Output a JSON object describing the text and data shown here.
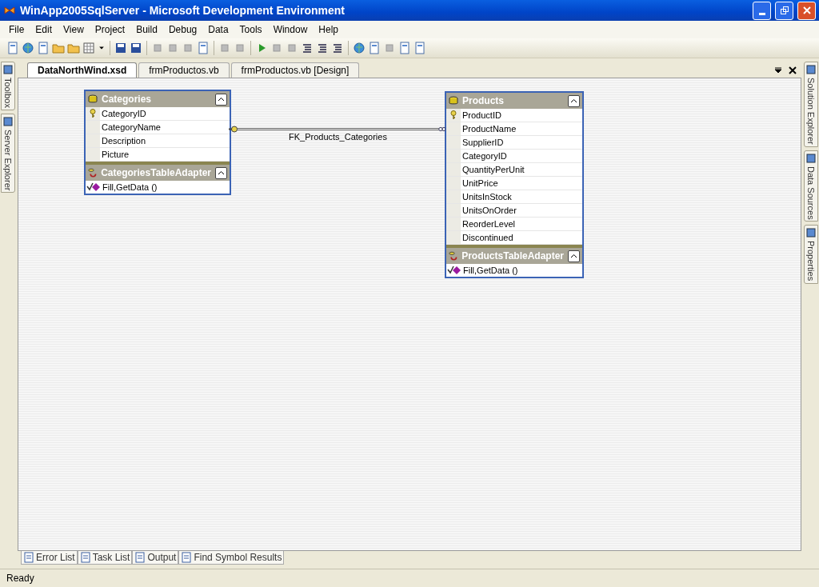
{
  "window": {
    "title": "WinApp2005SqlServer - Microsoft Development Environment"
  },
  "menu": [
    "File",
    "Edit",
    "View",
    "Project",
    "Build",
    "Debug",
    "Data",
    "Tools",
    "Window",
    "Help"
  ],
  "left_dock_tabs": [
    "Toolbox",
    "Server Explorer"
  ],
  "document_tabs": [
    {
      "label": "DataNorthWind.xsd",
      "selected": true
    },
    {
      "label": "frmProductos.vb",
      "selected": false
    },
    {
      "label": "frmProductos.vb [Design]",
      "selected": false
    }
  ],
  "diagram": {
    "tables": [
      {
        "name": "Categories",
        "columns": [
          {
            "name": "CategoryID",
            "primary_key": true
          },
          {
            "name": "CategoryName",
            "primary_key": false
          },
          {
            "name": "Description",
            "primary_key": false
          },
          {
            "name": "Picture",
            "primary_key": false
          }
        ],
        "adapter": {
          "name": "CategoriesTableAdapter",
          "queries": [
            "Fill,GetData ()"
          ]
        }
      },
      {
        "name": "Products",
        "columns": [
          {
            "name": "ProductID",
            "primary_key": true
          },
          {
            "name": "ProductName",
            "primary_key": false
          },
          {
            "name": "SupplierID",
            "primary_key": false
          },
          {
            "name": "CategoryID",
            "primary_key": false
          },
          {
            "name": "QuantityPerUnit",
            "primary_key": false
          },
          {
            "name": "UnitPrice",
            "primary_key": false
          },
          {
            "name": "UnitsInStock",
            "primary_key": false
          },
          {
            "name": "UnitsOnOrder",
            "primary_key": false
          },
          {
            "name": "ReorderLevel",
            "primary_key": false
          },
          {
            "name": "Discontinued",
            "primary_key": false
          }
        ],
        "adapter": {
          "name": "ProductsTableAdapter",
          "queries": [
            "Fill,GetData ()"
          ]
        }
      }
    ],
    "relations": [
      {
        "label": "FK_Products_Categories"
      }
    ]
  },
  "right_dock_tabs": [
    "Solution Explorer",
    "Data Sources",
    "Properties"
  ],
  "output_tabs": [
    "Error List",
    "Task List",
    "Output",
    "Find Symbol Results"
  ],
  "status_bar": "Ready"
}
